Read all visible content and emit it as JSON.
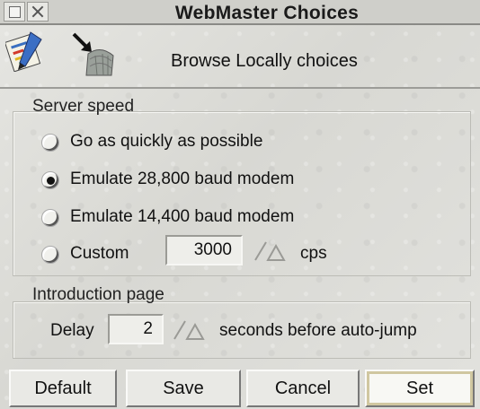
{
  "window": {
    "title": "WebMaster Choices",
    "header_title": "Browse Locally choices"
  },
  "server_speed": {
    "label": "Server speed",
    "options": [
      {
        "label": "Go as quickly as possible",
        "selected": false
      },
      {
        "label": "Emulate 28,800 baud modem",
        "selected": true
      },
      {
        "label": "Emulate 14,400 baud modem",
        "selected": false
      },
      {
        "label": "Custom",
        "selected": false
      }
    ],
    "custom_value": "3000",
    "custom_unit": "cps"
  },
  "introduction_page": {
    "label": "Introduction page",
    "delay_label": "Delay",
    "delay_value": "2",
    "delay_suffix": "seconds before auto-jump"
  },
  "buttons": {
    "default": "Default",
    "save": "Save",
    "cancel": "Cancel",
    "set": "Set"
  },
  "icons": {
    "back": "back-icon",
    "close": "close-icon",
    "app": "webmaster-app-icon",
    "arrow": "browse-arrow-icon",
    "stepper": "up-down-arrows-icon"
  }
}
